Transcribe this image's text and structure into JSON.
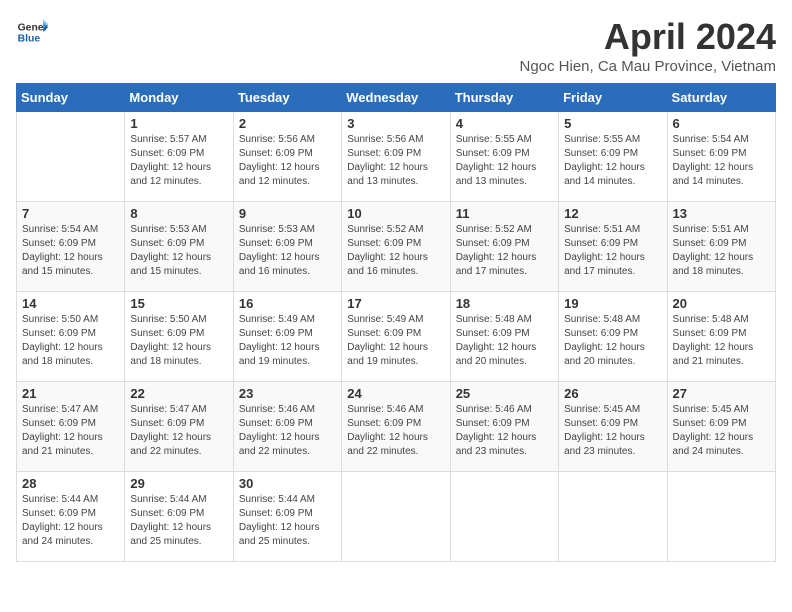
{
  "header": {
    "logo_line1": "General",
    "logo_line2": "Blue",
    "month_title": "April 2024",
    "subtitle": "Ngoc Hien, Ca Mau Province, Vietnam"
  },
  "days_of_week": [
    "Sunday",
    "Monday",
    "Tuesday",
    "Wednesday",
    "Thursday",
    "Friday",
    "Saturday"
  ],
  "weeks": [
    [
      {
        "day": "",
        "info": ""
      },
      {
        "day": "1",
        "info": "Sunrise: 5:57 AM\nSunset: 6:09 PM\nDaylight: 12 hours\nand 12 minutes."
      },
      {
        "day": "2",
        "info": "Sunrise: 5:56 AM\nSunset: 6:09 PM\nDaylight: 12 hours\nand 12 minutes."
      },
      {
        "day": "3",
        "info": "Sunrise: 5:56 AM\nSunset: 6:09 PM\nDaylight: 12 hours\nand 13 minutes."
      },
      {
        "day": "4",
        "info": "Sunrise: 5:55 AM\nSunset: 6:09 PM\nDaylight: 12 hours\nand 13 minutes."
      },
      {
        "day": "5",
        "info": "Sunrise: 5:55 AM\nSunset: 6:09 PM\nDaylight: 12 hours\nand 14 minutes."
      },
      {
        "day": "6",
        "info": "Sunrise: 5:54 AM\nSunset: 6:09 PM\nDaylight: 12 hours\nand 14 minutes."
      }
    ],
    [
      {
        "day": "7",
        "info": "Sunrise: 5:54 AM\nSunset: 6:09 PM\nDaylight: 12 hours\nand 15 minutes."
      },
      {
        "day": "8",
        "info": "Sunrise: 5:53 AM\nSunset: 6:09 PM\nDaylight: 12 hours\nand 15 minutes."
      },
      {
        "day": "9",
        "info": "Sunrise: 5:53 AM\nSunset: 6:09 PM\nDaylight: 12 hours\nand 16 minutes."
      },
      {
        "day": "10",
        "info": "Sunrise: 5:52 AM\nSunset: 6:09 PM\nDaylight: 12 hours\nand 16 minutes."
      },
      {
        "day": "11",
        "info": "Sunrise: 5:52 AM\nSunset: 6:09 PM\nDaylight: 12 hours\nand 17 minutes."
      },
      {
        "day": "12",
        "info": "Sunrise: 5:51 AM\nSunset: 6:09 PM\nDaylight: 12 hours\nand 17 minutes."
      },
      {
        "day": "13",
        "info": "Sunrise: 5:51 AM\nSunset: 6:09 PM\nDaylight: 12 hours\nand 18 minutes."
      }
    ],
    [
      {
        "day": "14",
        "info": "Sunrise: 5:50 AM\nSunset: 6:09 PM\nDaylight: 12 hours\nand 18 minutes."
      },
      {
        "day": "15",
        "info": "Sunrise: 5:50 AM\nSunset: 6:09 PM\nDaylight: 12 hours\nand 18 minutes."
      },
      {
        "day": "16",
        "info": "Sunrise: 5:49 AM\nSunset: 6:09 PM\nDaylight: 12 hours\nand 19 minutes."
      },
      {
        "day": "17",
        "info": "Sunrise: 5:49 AM\nSunset: 6:09 PM\nDaylight: 12 hours\nand 19 minutes."
      },
      {
        "day": "18",
        "info": "Sunrise: 5:48 AM\nSunset: 6:09 PM\nDaylight: 12 hours\nand 20 minutes."
      },
      {
        "day": "19",
        "info": "Sunrise: 5:48 AM\nSunset: 6:09 PM\nDaylight: 12 hours\nand 20 minutes."
      },
      {
        "day": "20",
        "info": "Sunrise: 5:48 AM\nSunset: 6:09 PM\nDaylight: 12 hours\nand 21 minutes."
      }
    ],
    [
      {
        "day": "21",
        "info": "Sunrise: 5:47 AM\nSunset: 6:09 PM\nDaylight: 12 hours\nand 21 minutes."
      },
      {
        "day": "22",
        "info": "Sunrise: 5:47 AM\nSunset: 6:09 PM\nDaylight: 12 hours\nand 22 minutes."
      },
      {
        "day": "23",
        "info": "Sunrise: 5:46 AM\nSunset: 6:09 PM\nDaylight: 12 hours\nand 22 minutes."
      },
      {
        "day": "24",
        "info": "Sunrise: 5:46 AM\nSunset: 6:09 PM\nDaylight: 12 hours\nand 22 minutes."
      },
      {
        "day": "25",
        "info": "Sunrise: 5:46 AM\nSunset: 6:09 PM\nDaylight: 12 hours\nand 23 minutes."
      },
      {
        "day": "26",
        "info": "Sunrise: 5:45 AM\nSunset: 6:09 PM\nDaylight: 12 hours\nand 23 minutes."
      },
      {
        "day": "27",
        "info": "Sunrise: 5:45 AM\nSunset: 6:09 PM\nDaylight: 12 hours\nand 24 minutes."
      }
    ],
    [
      {
        "day": "28",
        "info": "Sunrise: 5:44 AM\nSunset: 6:09 PM\nDaylight: 12 hours\nand 24 minutes."
      },
      {
        "day": "29",
        "info": "Sunrise: 5:44 AM\nSunset: 6:09 PM\nDaylight: 12 hours\nand 25 minutes."
      },
      {
        "day": "30",
        "info": "Sunrise: 5:44 AM\nSunset: 6:09 PM\nDaylight: 12 hours\nand 25 minutes."
      },
      {
        "day": "",
        "info": ""
      },
      {
        "day": "",
        "info": ""
      },
      {
        "day": "",
        "info": ""
      },
      {
        "day": "",
        "info": ""
      }
    ]
  ]
}
